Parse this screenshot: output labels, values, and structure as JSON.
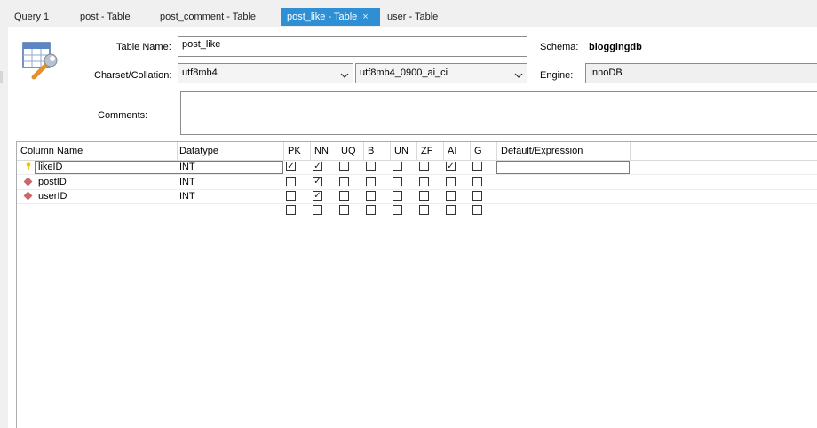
{
  "tabs": [
    {
      "label": "Query 1",
      "active": false
    },
    {
      "label": "post - Table",
      "active": false
    },
    {
      "label": "post_comment - Table",
      "active": false
    },
    {
      "label": "post_like - Table",
      "active": true
    },
    {
      "label": "user - Table",
      "active": false
    }
  ],
  "tab_close_glyph": "×",
  "form": {
    "table_name_label": "Table Name:",
    "table_name_value": "post_like",
    "schema_label": "Schema:",
    "schema_value": "bloggingdb",
    "charset_label": "Charset/Collation:",
    "charset_value": "utf8mb4",
    "collation_value": "utf8mb4_0900_ai_ci",
    "engine_label": "Engine:",
    "engine_value": "InnoDB",
    "comments_label": "Comments:",
    "comments_value": ""
  },
  "icons": {
    "table_icon": "table-wrench-icon",
    "dropdown": "chevron-down-icon",
    "primary_key": "key-icon",
    "column": "diamond-icon"
  },
  "colors": {
    "active_tab": "#2f8fd5",
    "key_icon": "#f2c200",
    "column_icon": "#c8686a"
  },
  "grid": {
    "headers": [
      "Column Name",
      "Datatype",
      "PK",
      "NN",
      "UQ",
      "B",
      "UN",
      "ZF",
      "AI",
      "G",
      "Default/Expression"
    ],
    "rows": [
      {
        "name": "likeID",
        "type": "INT",
        "icon": "key",
        "flags": [
          true,
          true,
          false,
          false,
          false,
          false,
          true,
          false
        ],
        "default": ""
      },
      {
        "name": "postID",
        "type": "INT",
        "icon": "column",
        "flags": [
          false,
          true,
          false,
          false,
          false,
          false,
          false,
          false
        ],
        "default": ""
      },
      {
        "name": "userID",
        "type": "INT",
        "icon": "column",
        "flags": [
          false,
          true,
          false,
          false,
          false,
          false,
          false,
          false
        ],
        "default": ""
      },
      {
        "name": "",
        "type": "",
        "icon": "",
        "flags": [
          false,
          false,
          false,
          false,
          false,
          false,
          false,
          false
        ],
        "default": ""
      }
    ],
    "check_glyph": "✓"
  }
}
